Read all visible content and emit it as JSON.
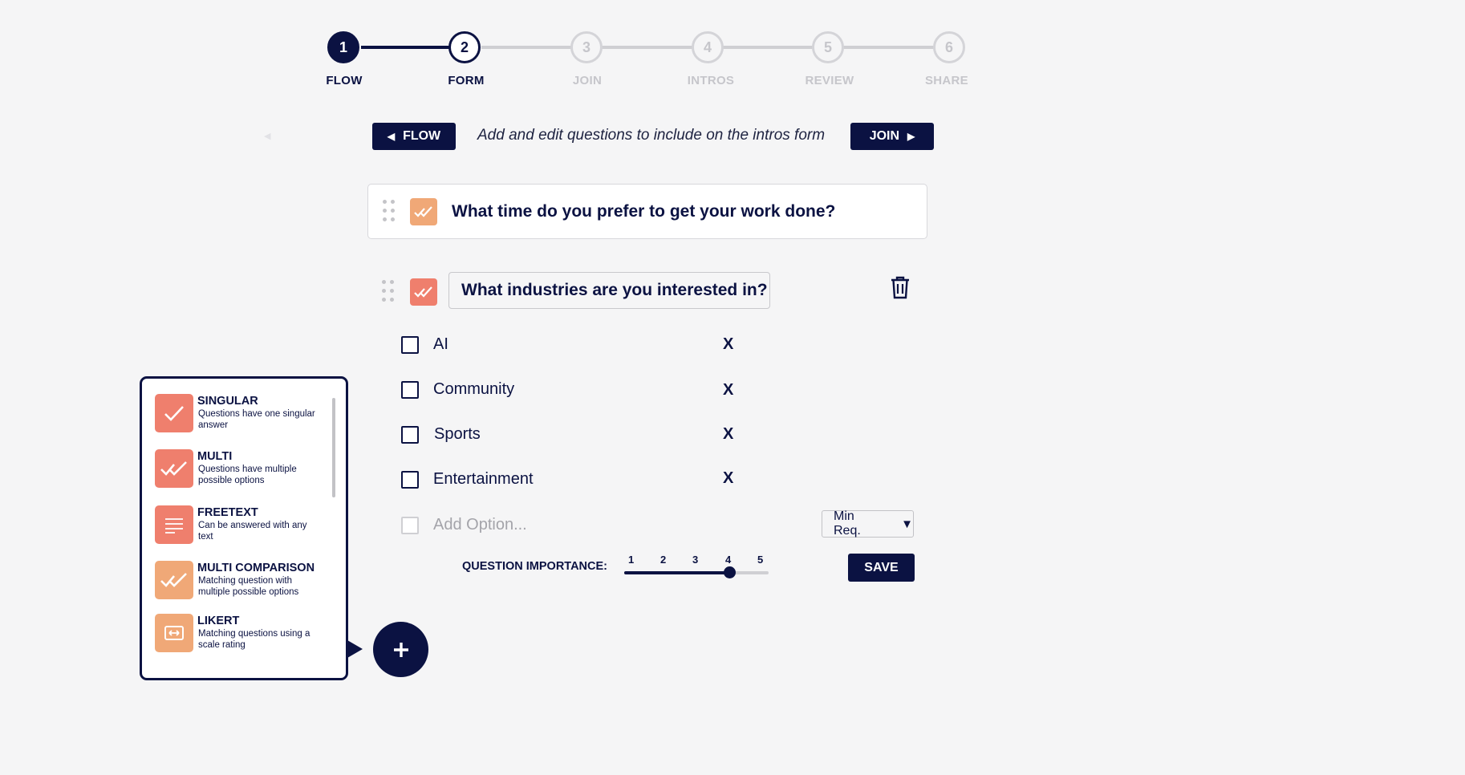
{
  "stepper": {
    "steps": [
      {
        "num": "1",
        "label": "FLOW"
      },
      {
        "num": "2",
        "label": "FORM"
      },
      {
        "num": "3",
        "label": "JOIN"
      },
      {
        "num": "4",
        "label": "INTROS"
      },
      {
        "num": "5",
        "label": "REVIEW"
      },
      {
        "num": "6",
        "label": "SHARE"
      }
    ],
    "completed_step": 1,
    "active_step": 2
  },
  "nav": {
    "back_label": "FLOW",
    "next_label": "JOIN",
    "description": "Add and edit questions to include on the intros form"
  },
  "questions": [
    {
      "title": "What time do you prefer to get your work done?"
    },
    {
      "title": "What industries are you interested in?"
    }
  ],
  "editor": {
    "options": [
      {
        "label": "AI",
        "remove": "X"
      },
      {
        "label": "Community",
        "remove": "X"
      },
      {
        "label": "Sports",
        "remove": "X"
      },
      {
        "label": "Entertainment",
        "remove": "X"
      }
    ],
    "add_option_placeholder": "Add Option...",
    "min_req_label": "Min Req.",
    "importance_label": "QUESTION IMPORTANCE:",
    "importance_ticks": [
      "1",
      "2",
      "3",
      "4",
      "5"
    ],
    "importance_value": 4,
    "save_label": "SAVE"
  },
  "type_menu": {
    "items": [
      {
        "name": "SINGULAR",
        "desc": "Questions have one singular answer",
        "icon": "check-icon",
        "color": "#ef7f6d"
      },
      {
        "name": "MULTI",
        "desc": "Questions have multiple possible options",
        "icon": "double-check-icon",
        "color": "#ef7f6d"
      },
      {
        "name": "FREETEXT",
        "desc": "Can be answered with any text",
        "icon": "text-lines-icon",
        "color": "#ef7f6d"
      },
      {
        "name": "MULTI COMPARISON",
        "desc": "Matching question with multiple possible options",
        "icon": "double-check-icon",
        "color": "#f0a877"
      },
      {
        "name": "LIKERT",
        "desc": "Matching questions using a scale rating",
        "icon": "scale-arrows-icon",
        "color": "#f0a877"
      }
    ]
  },
  "colors": {
    "navy": "#0b1242",
    "coral": "#ef7f6d",
    "peach": "#f0a877",
    "inactive": "#cfcfd3"
  }
}
